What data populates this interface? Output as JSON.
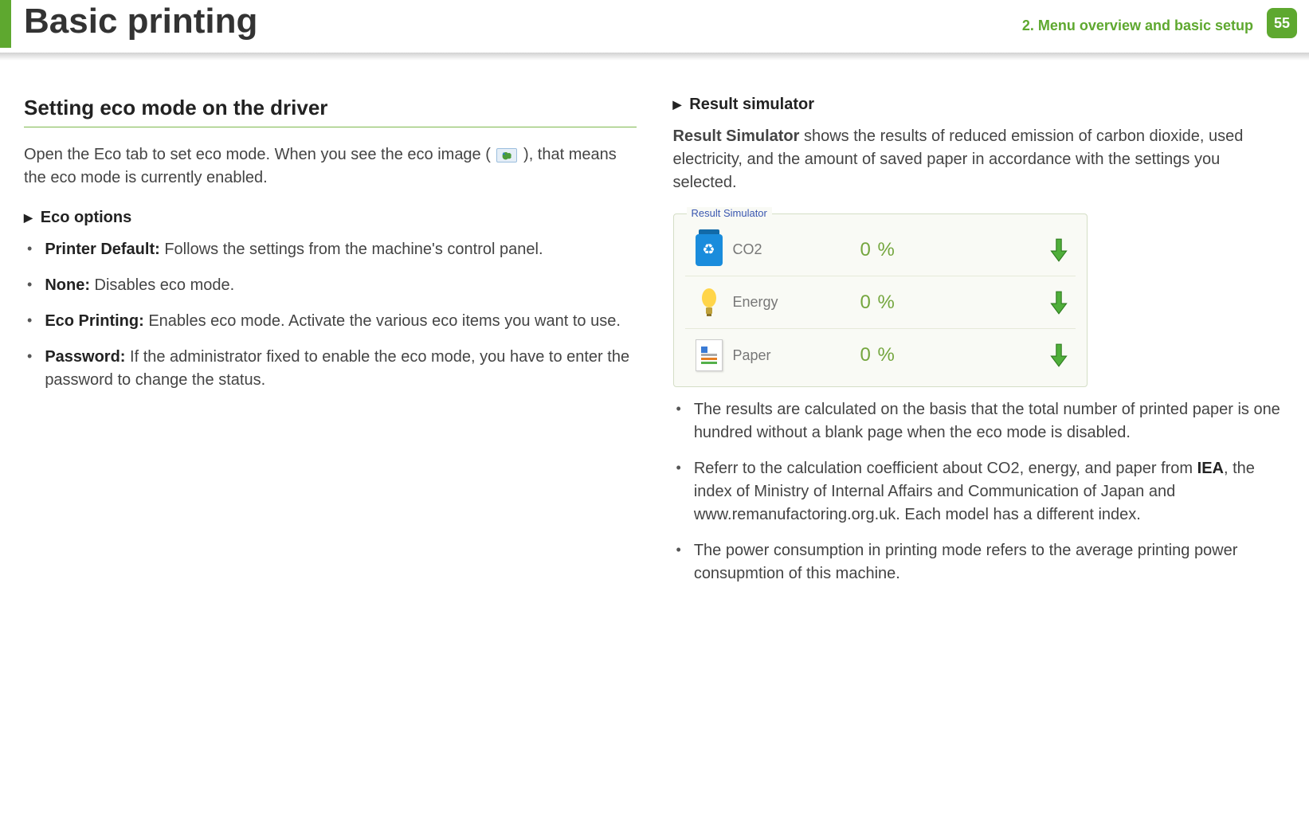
{
  "header": {
    "title": "Basic printing",
    "chapter": "2.  Menu overview and basic setup",
    "page": "55"
  },
  "left": {
    "section": "Setting eco mode on the driver",
    "intro_a": "Open the Eco tab to set eco mode. When you see the eco image (",
    "intro_b": "), that means the eco mode is currently enabled.",
    "sub": "Eco options",
    "items": [
      {
        "t": "Printer Default:",
        "d": " Follows the settings from the machine's control panel."
      },
      {
        "t": "None:",
        "d": " Disables eco mode."
      },
      {
        "t": "Eco Printing:",
        "d": " Enables eco mode. Activate the various eco items you want to use."
      },
      {
        "t": "Password:",
        "d": " If the administrator fixed to enable the eco mode, you have to enter the password to change the status."
      }
    ]
  },
  "right": {
    "sub": "Result simulator",
    "lead_t": "Result Simulator",
    "lead_d": " shows the results of reduced emission of carbon dioxide, used electricity, and the amount of saved paper in accordance with the settings you selected.",
    "sim": {
      "title": "Result Simulator",
      "rows": [
        {
          "label": "CO2",
          "value": "0 %"
        },
        {
          "label": "Energy",
          "value": "0 %"
        },
        {
          "label": "Paper",
          "value": "0 %"
        }
      ]
    },
    "notes": [
      "The results are calculated on the basis that the total number of printed paper is one hundred without a blank page when the eco mode is disabled.",
      {
        "a": "Referr to the calculation coefficient about CO2, energy, and paper from ",
        "b": "IEA",
        "c": ", the index of Ministry of Internal Affairs and Communication of Japan and www.remanufactoring.org.uk. Each model has a different index."
      },
      "The power consumption in printing mode refers to the average printing power consupmtion of this machine."
    ]
  }
}
